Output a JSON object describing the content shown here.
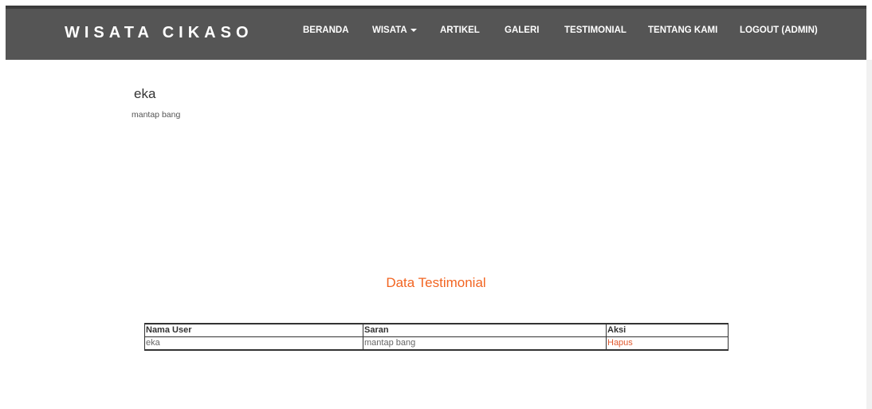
{
  "navbar": {
    "brand": "WISATA CIKASO",
    "items": [
      {
        "label": "BERANDA"
      },
      {
        "label": "WISATA"
      },
      {
        "label": "ARTIKEL"
      },
      {
        "label": "GALERI"
      },
      {
        "label": "TESTIMONIAL"
      },
      {
        "label": "TENTANG KAMI"
      },
      {
        "label": "LOGOUT (ADMIN)"
      }
    ]
  },
  "testimonial": {
    "name": "eka",
    "message": "mantap bang"
  },
  "section": {
    "title": "Data Testimonial"
  },
  "table": {
    "headers": [
      "Nama User",
      "Saran",
      "Aksi"
    ],
    "rows": [
      {
        "user": "eka",
        "saran": "mantap bang",
        "aksi": "Hapus"
      }
    ]
  },
  "colors": {
    "navbar_bg": "#555555",
    "accent_orange": "#f26522",
    "link_red": "#e05a30"
  }
}
